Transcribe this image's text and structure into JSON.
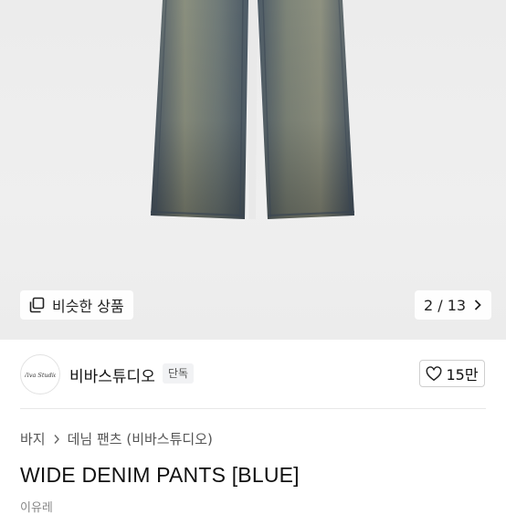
{
  "gallery": {
    "similar_label": "비슷한 상품",
    "counter_text": "2 / 13",
    "image_icon": "jeans-product-image",
    "similar_icon": "stacked-squares-icon",
    "next_icon": "chevron-right-icon"
  },
  "seller": {
    "name": "비바스튜디오",
    "badge": "단독",
    "logo_text": "Viva Studio",
    "likes_label": "15만",
    "like_icon": "heart-outline-icon"
  },
  "breadcrumb": [
    "바지",
    "데님 팬츠 (비바스튜디오)"
  ],
  "product": {
    "title": "WIDE DENIM PANTS [BLUE]",
    "subtext_cut": "이유레"
  },
  "colors": {
    "denim_dark": "#3f4d5c",
    "denim_mid": "#5a6a76",
    "denim_faded": "#9a9a7a",
    "background": "#eeeeee"
  }
}
